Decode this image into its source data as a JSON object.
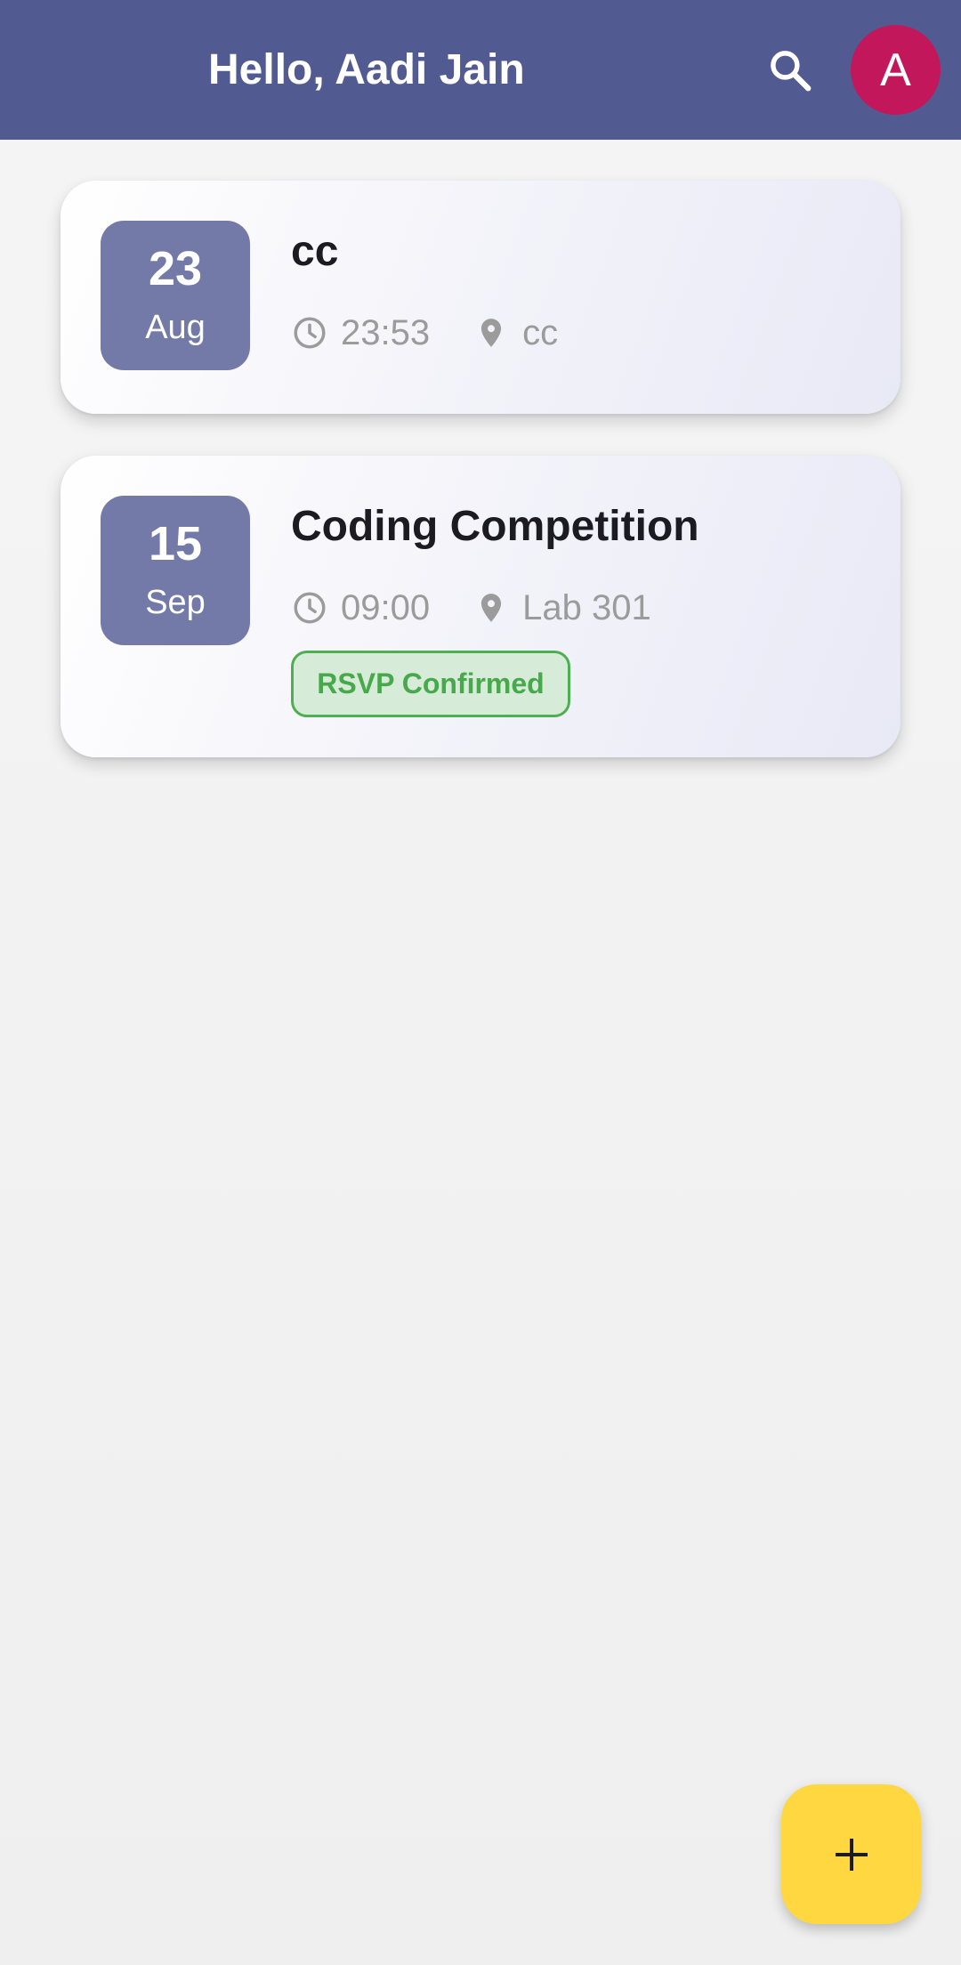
{
  "app_bar": {
    "title": "Hello, Aadi Jain",
    "background_color": "#525a92",
    "search_icon": "search-icon",
    "avatar_initial": "A",
    "avatar_color": "#c2185b"
  },
  "events": [
    {
      "day": "23",
      "month": "Aug",
      "title": "cc",
      "time": "23:53",
      "location": "cc",
      "time_icon": "clock-icon",
      "location_icon": "location-pin-icon"
    },
    {
      "day": "15",
      "month": "Sep",
      "title": "Coding Competition",
      "time": "09:00",
      "location": "Lab 301",
      "time_icon": "clock-icon",
      "location_icon": "location-pin-icon",
      "badge": "RSVP Confirmed",
      "badge_color": "#4caf50"
    }
  ],
  "fab": {
    "icon": "plus-icon",
    "color": "#ffd740"
  }
}
